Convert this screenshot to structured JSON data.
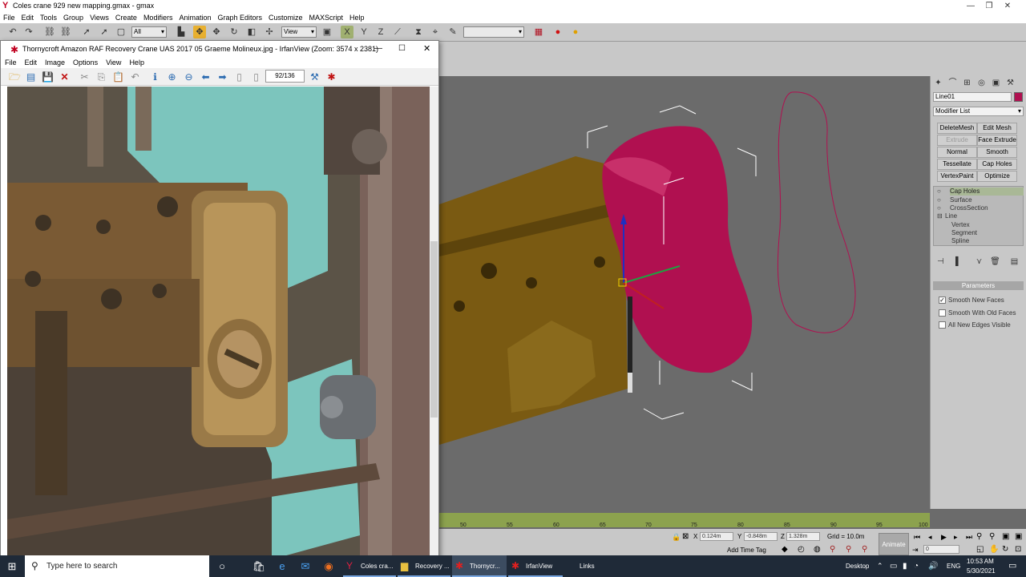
{
  "gmax": {
    "title": "Coles crane 929 new mapping.gmax - gmax",
    "menu": [
      "File",
      "Edit",
      "Tools",
      "Group",
      "Views",
      "Create",
      "Modifiers",
      "Animation",
      "Graph Editors",
      "Customize",
      "MAXScript",
      "Help"
    ],
    "selection_filter": "All",
    "reference_coord": "View",
    "named_selection": "",
    "command_panel": {
      "object_name": "Line01",
      "modifier_list": "Modifier List",
      "buttons": [
        "DeleteMesh",
        "Edit Mesh",
        "Extrude",
        "Face Extrude",
        "Normal",
        "Smooth",
        "Tessellate",
        "Cap Holes",
        "VertexPaint",
        "Optimize"
      ],
      "disabled_button": "Extrude",
      "stack": [
        "Cap Holes",
        "Surface",
        "CrossSection",
        "Line",
        "Vertex",
        "Segment",
        "Spline"
      ],
      "rollout": "Parameters",
      "checkboxes": [
        {
          "label": "Smooth New Faces",
          "checked": true
        },
        {
          "label": "Smooth With Old Faces",
          "checked": false
        },
        {
          "label": "All New Edges Visible",
          "checked": false
        }
      ]
    },
    "timeline_ticks": [
      "50",
      "55",
      "60",
      "65",
      "70",
      "75",
      "80",
      "85",
      "90",
      "95",
      "100"
    ],
    "status": {
      "x": "0.124m",
      "y": "-0.848m",
      "z": "1.328m",
      "x_label": "X",
      "y_label": "Y",
      "z_label": "Z",
      "grid": "Grid = 10.0m",
      "add_time_tag": "Add Time Tag",
      "animate": "Animate",
      "frame": "0"
    },
    "colors": {
      "object": "#b01050",
      "spline": "#b01050",
      "body": "#7a5a12"
    }
  },
  "irfanview": {
    "title": "Thornycroft Amazon RAF Recovery Crane UAS 2017 05 Graeme Molineux.jpg - IrfanView (Zoom: 3574 x 2381)",
    "menu": [
      "File",
      "Edit",
      "Image",
      "Options",
      "View",
      "Help"
    ],
    "page_counter": "92/136"
  },
  "taskbar": {
    "search_placeholder": "Type here to search",
    "apps": [
      {
        "label": "Coles cra...",
        "active": false
      },
      {
        "label": "Recovery ...",
        "active": false
      },
      {
        "label": "Thornycr...",
        "active": true
      },
      {
        "label": "IrfanView",
        "active": false
      }
    ],
    "links": "Links",
    "desktop": "Desktop",
    "lang": "ENG",
    "time": "10:53 AM",
    "date": "5/30/2021"
  }
}
